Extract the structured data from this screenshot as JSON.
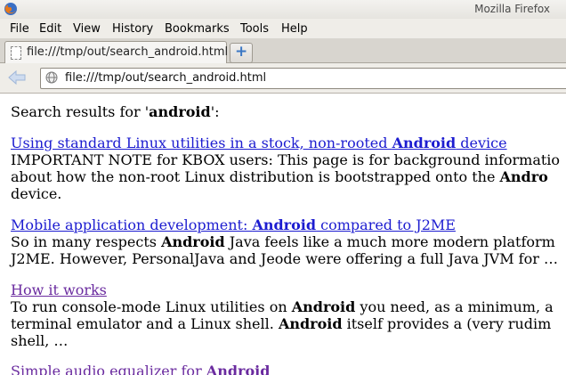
{
  "window": {
    "title": "Mozilla Firefox"
  },
  "menubar": {
    "items": [
      "File",
      "Edit",
      "View",
      "History",
      "Bookmarks",
      "Tools",
      "Help"
    ]
  },
  "tab": {
    "label": "file:///tmp/out/search_android.html",
    "new_tab_glyph": "+"
  },
  "navbar": {
    "url": "file:///tmp/out/search_android.html"
  },
  "page": {
    "heading_prefix": "Search results for '",
    "query": "android",
    "heading_suffix": "':",
    "results": [
      {
        "title_pre": "Using standard Linux utilities in a stock, non-rooted ",
        "title_term": "Android",
        "title_post": " device",
        "visited": false,
        "lines": [
          [
            "IMPORTANT NOTE for KBOX users: This page is for background informatio",
            "",
            ""
          ],
          [
            "about how the non-root Linux distribution is bootstrapped onto the ",
            "Andro",
            ""
          ],
          [
            "device.",
            "",
            ""
          ]
        ]
      },
      {
        "title_pre": "Mobile application development: ",
        "title_term": "Android",
        "title_post": " compared to J2ME",
        "visited": false,
        "lines": [
          [
            "So in many respects ",
            "Android",
            " Java feels like a much more modern platform"
          ],
          [
            "J2ME. However, PersonalJava and Jeode were offering a full Java JVM for …",
            "",
            ""
          ]
        ]
      },
      {
        "title_pre": "How it works",
        "title_term": "",
        "title_post": "",
        "visited": true,
        "lines": [
          [
            "To run console-mode Linux utilities on ",
            "Android",
            " you need, as a minimum, a"
          ],
          [
            "terminal emulator and a Linux shell. ",
            "Android",
            " itself provides a (very rudim"
          ],
          [
            "shell, …",
            "",
            ""
          ]
        ]
      },
      {
        "title_pre": "Simple audio equalizer for ",
        "title_term": "Android",
        "title_post": "",
        "visited": true,
        "lines": []
      }
    ]
  }
}
